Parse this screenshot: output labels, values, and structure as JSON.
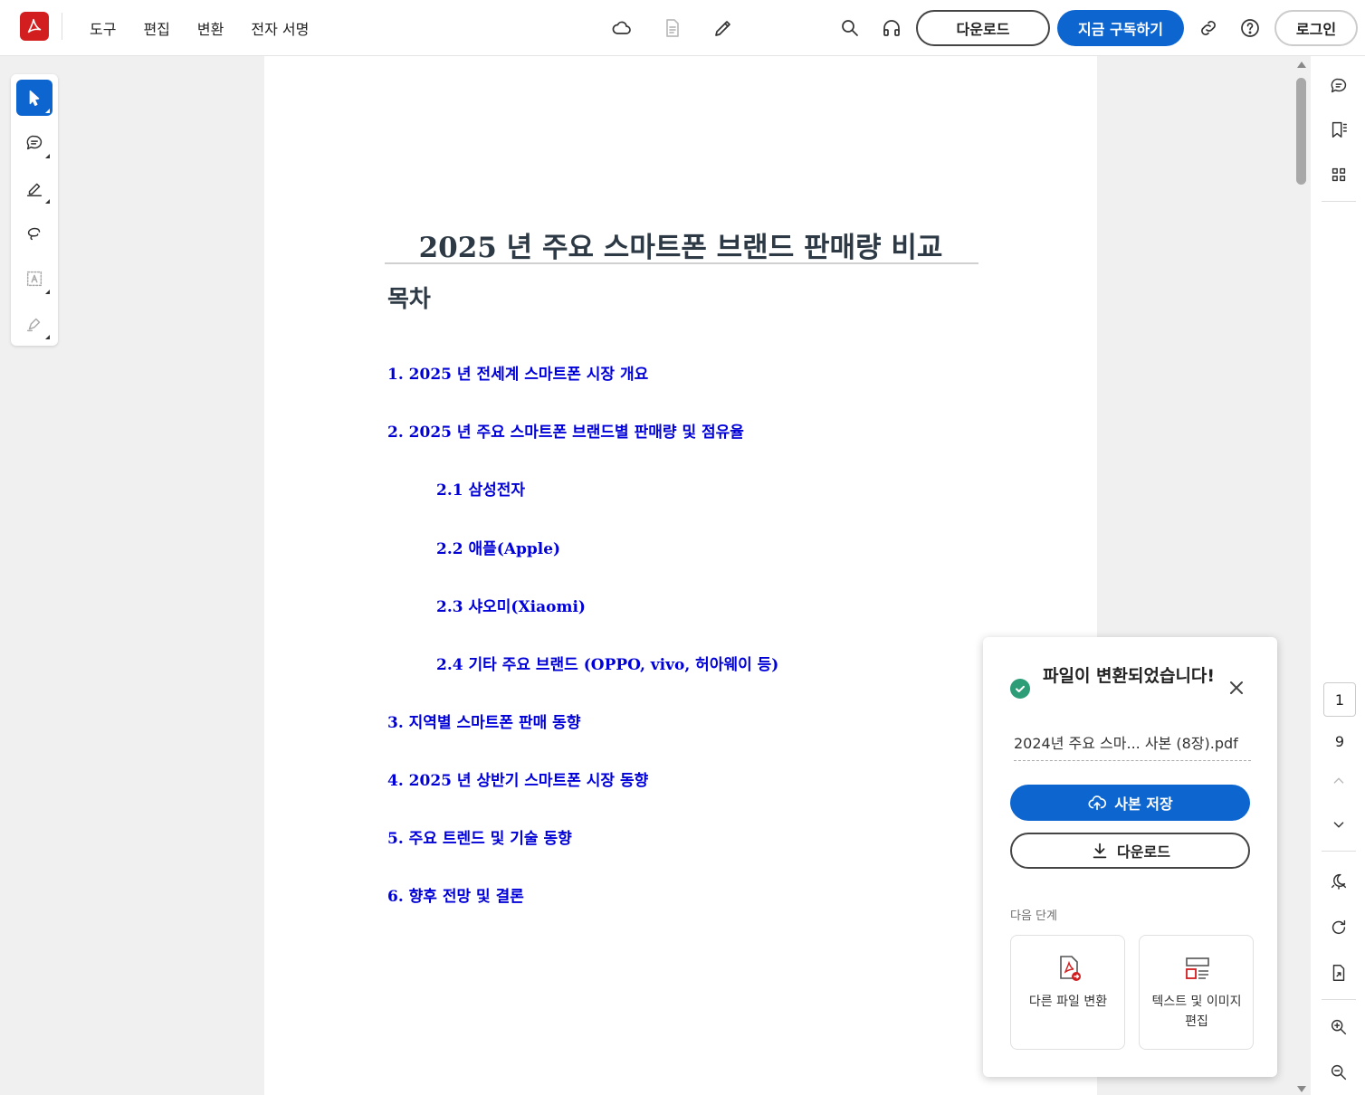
{
  "topbar": {
    "menu": [
      "도구",
      "편집",
      "변환",
      "전자 서명"
    ],
    "center_icons": [
      "cloud-icon",
      "document-icon",
      "pen-icon"
    ],
    "download_label": "다운로드",
    "subscribe_label": "지금 구독하기",
    "login_label": "로그인",
    "right_icons": [
      "search-icon",
      "headphones-icon",
      "link-icon",
      "help-icon"
    ]
  },
  "left_tools": [
    "select-cursor-icon",
    "comment-icon",
    "highlight-pen-icon",
    "lasso-draw-icon",
    "text-box-icon",
    "signature-icon"
  ],
  "document": {
    "title": "2025 년 주요 스마트폰 브랜드 판매량 비교",
    "toc_heading": "목차",
    "toc": [
      {
        "label": "1. 2025 년 전세계 스마트폰 시장 개요",
        "indent": false
      },
      {
        "label": "2. 2025 년 주요 스마트폰 브랜드별 판매량 및 점유율",
        "indent": false
      },
      {
        "label": "2.1 삼성전자",
        "indent": true
      },
      {
        "label": "2.2 애플(Apple)",
        "indent": true
      },
      {
        "label": "2.3 샤오미(Xiaomi)",
        "indent": true
      },
      {
        "label": "2.4 기타 주요 브랜드 (OPPO, vivo, 허아웨이 등)",
        "indent": true
      },
      {
        "label": "3. 지역별 스마트폰 판매 동향",
        "indent": false
      },
      {
        "label": "4. 2025 년 상반기 스마트폰 시장 동향",
        "indent": false
      },
      {
        "label": "5. 주요 트렌드 및 기술 동향",
        "indent": false
      },
      {
        "label": "6. 향후 전망 및 결론",
        "indent": false
      }
    ]
  },
  "right_rail": {
    "current_page": "1",
    "total_pages": "9",
    "icons": [
      "comments-icon",
      "bookmark-icon",
      "thumbnails-icon",
      "page-up-icon",
      "page-down-icon",
      "dark-mode-icon",
      "rotate-icon",
      "extract-page-icon",
      "zoom-in-icon",
      "zoom-out-icon"
    ]
  },
  "notification": {
    "title": "파일이 변환되었습니다!",
    "filename": "2024년 주요 스마... 사본 (8장).pdf",
    "save_copy_label": "사본 저장",
    "download_label": "다운로드",
    "next_steps_label": "다음 단계",
    "cards": [
      {
        "label": "다른 파일 변환",
        "icon": "convert-file-icon"
      },
      {
        "label": "텍스트 및 이미지 편집",
        "icon": "edit-text-image-icon"
      }
    ]
  },
  "colors": {
    "accent": "#0d66d0",
    "brand": "#d21e1e",
    "link": "#0000d8",
    "success": "#2d9d78"
  }
}
